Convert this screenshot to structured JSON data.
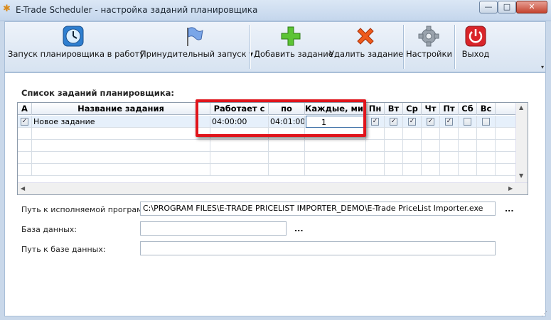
{
  "window": {
    "title": "E-Trade Scheduler - настройка заданий планировщика",
    "minimize": "—",
    "maximize": "□",
    "close": "✕"
  },
  "toolbar": {
    "start": "Запуск планировщика в работу",
    "force": "Принудительный запуск",
    "add": "Добавить задание",
    "delete": "Удалить задание",
    "settings": "Настройки",
    "exit": "Выход",
    "icons": {
      "start": "clock-icon",
      "force": "flag-icon",
      "add": "plus-icon",
      "delete": "x-icon",
      "settings": "gear-icon",
      "exit": "power-icon"
    }
  },
  "tasks": {
    "title": "Список заданий планировщика:",
    "columns": [
      "А",
      "Название задания",
      "Работает с",
      "по",
      "Каждые, мин",
      "Пн",
      "Вт",
      "Ср",
      "Чт",
      "Пт",
      "Сб",
      "Вс"
    ],
    "rows": [
      {
        "active": true,
        "name": "Новое задание",
        "from": "04:00:00",
        "to": "04:01:00",
        "every": "1",
        "days": [
          true,
          true,
          true,
          true,
          true,
          false,
          false
        ]
      }
    ]
  },
  "fields": {
    "program_label": "Путь к исполняемой программе:",
    "program_value": "C:\\PROGRAM FILES\\E-TRADE PRICELIST IMPORTER_DEMO\\E-Trade PriceList Importer.exe",
    "db_label": "База данных:",
    "db_value": "",
    "dbpath_label": "Путь к базе данных:",
    "dbpath_value": "",
    "browse": "..."
  },
  "colors": {
    "highlight": "#e0141b",
    "selected_row": "#e6f0fb"
  }
}
